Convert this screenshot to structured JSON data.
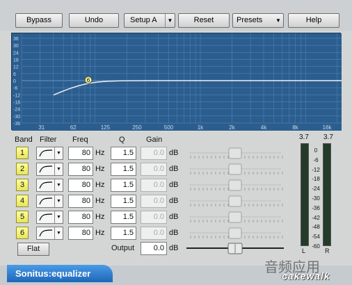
{
  "toolbar": {
    "bypass": "Bypass",
    "undo": "Undo",
    "setup": "Setup A",
    "reset": "Reset",
    "presets": "Presets",
    "help": "Help"
  },
  "graph": {
    "y_labels": [
      "36",
      "30",
      "24",
      "18",
      "12",
      "6",
      "0",
      "-6",
      "-12",
      "-18",
      "-24",
      "-30",
      "-36"
    ],
    "x_labels": [
      "31",
      "62",
      "125",
      "250",
      "500",
      "1k",
      "2k",
      "4k",
      "8k",
      "16k"
    ],
    "marker_label": "6",
    "curve_color": "#f0f0f0",
    "background_color": "#2b5e8f"
  },
  "headers": {
    "band": "Band",
    "filter": "Filter",
    "freq": "Freq",
    "q": "Q",
    "gain": "Gain"
  },
  "bands": [
    {
      "num": "1",
      "freq": "80",
      "q": "1.5",
      "gain": "0.0"
    },
    {
      "num": "2",
      "freq": "80",
      "q": "1.5",
      "gain": "0.0"
    },
    {
      "num": "3",
      "freq": "80",
      "q": "1.5",
      "gain": "0.0"
    },
    {
      "num": "4",
      "freq": "80",
      "q": "1.5",
      "gain": "0.0"
    },
    {
      "num": "5",
      "freq": "80",
      "q": "1.5",
      "gain": "0.0"
    },
    {
      "num": "6",
      "freq": "80",
      "q": "1.5",
      "gain": "0.0"
    }
  ],
  "units": {
    "hz": "Hz",
    "db": "dB"
  },
  "flat": "Flat",
  "output": {
    "label": "Output",
    "value": "0.0",
    "unit": "dB"
  },
  "meters": {
    "left_peak": "3.7",
    "right_peak": "3.7",
    "scale": [
      "0",
      "-6",
      "-12",
      "-18",
      "-24",
      "-30",
      "-36",
      "-42",
      "-48",
      "-54",
      "-60"
    ],
    "left_label": "L",
    "right_label": "R",
    "left_level": 0.0,
    "right_level": 0.0
  },
  "footer": {
    "title": "Sonitus:equalizer",
    "brand": "cakewalk",
    "watermark": "音频应用"
  }
}
